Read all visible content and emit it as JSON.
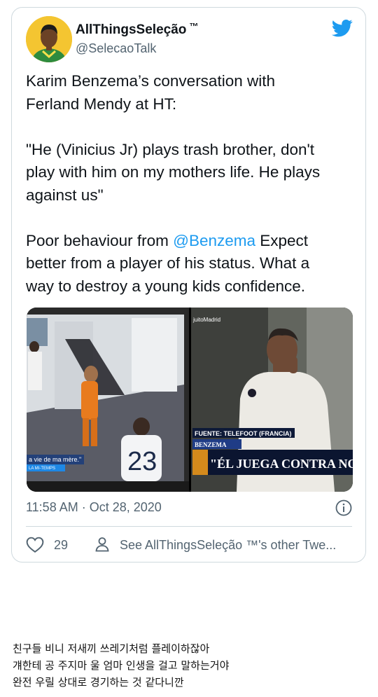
{
  "tweet": {
    "display_name": "AllThingsSeleção",
    "trademark": "™",
    "handle": "@SelecaoTalk",
    "text_lines": [
      "Karim Benzema’s conversation with",
      "Ferland Mendy at HT:",
      "\"He (Vinicius Jr) plays trash brother, don't",
      "play with him on my mothers life. He plays",
      "against us\""
    ],
    "line_poor_prefix": "Poor behaviour from ",
    "mention": "@Benzema",
    "line_poor_suffix": " Expect",
    "line_last_1": "better from a player of his status. What a",
    "line_last_2": "way to destroy a young kids confidence.",
    "media": {
      "left_overlay": "a vie de ma mère.\"",
      "left_overlay_small": "LA MI-TEMPS",
      "left_jersey_number": "23",
      "right_watermark": "juitoMadrid",
      "right_source": "FUENTE: TELEFOOT (FRANCIA)",
      "right_name_tag": "BENZEMA",
      "right_headline": "\"ÉL JUEGA CONTRA NO"
    },
    "timestamp": "11:58 AM · Oct 28, 2020",
    "like_count": "29",
    "other_tweets_label": "See AllThingsSeleção ™'s other Twe..."
  },
  "caption": [
    "친구들 비니 저새끼 쓰레기처럼 플레이하잖아",
    "걔한테 공 주지마 울 엄마 인생을 걸고 말하는거야",
    "완전 우릴 상대로 경기하는 것 같다니깐"
  ],
  "colors": {
    "twitter_blue": "#1d9bf0",
    "text": "#0f1419",
    "secondary": "#536471",
    "border": "#cfd9de"
  }
}
